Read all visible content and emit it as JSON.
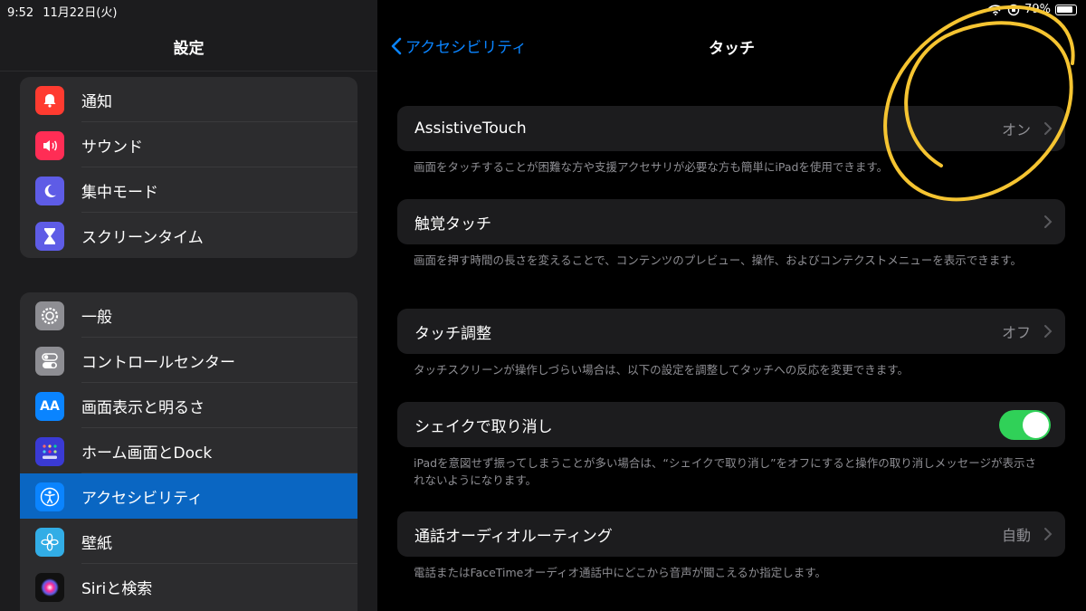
{
  "status": {
    "time": "9:52",
    "date": "11月22日(火)",
    "battery": "79%"
  },
  "sidebar": {
    "title": "設定",
    "group1": [
      {
        "label": "通知",
        "icon": "bell-icon",
        "color": "#ff3b30"
      },
      {
        "label": "サウンド",
        "icon": "speaker-icon",
        "color": "#ff2d55"
      },
      {
        "label": "集中モード",
        "icon": "moon-icon",
        "color": "#5e5ce6"
      },
      {
        "label": "スクリーンタイム",
        "icon": "hourglass-icon",
        "color": "#5e5ce6"
      }
    ],
    "group2": [
      {
        "label": "一般",
        "icon": "gear-icon",
        "color": "#8e8e93"
      },
      {
        "label": "コントロールセンター",
        "icon": "toggles-icon",
        "color": "#8e8e93"
      },
      {
        "label": "画面表示と明るさ",
        "icon": "text-size-icon",
        "icon_text": "AA",
        "color": "#0a84ff"
      },
      {
        "label": "ホーム画面とDock",
        "icon": "home-grid-icon",
        "color": "#3a3ad4"
      },
      {
        "label": "アクセシビリティ",
        "icon": "accessibility-icon",
        "color": "#0a84ff",
        "selected": true
      },
      {
        "label": "壁紙",
        "icon": "flower-icon",
        "color": "#32ade6"
      },
      {
        "label": "Siriと検索",
        "icon": "siri-icon",
        "color": "#111111"
      }
    ]
  },
  "nav": {
    "back_label": "アクセシビリティ",
    "title": "タッチ"
  },
  "settings": [
    {
      "label": "AssistiveTouch",
      "value": "オン",
      "desc": "画面をタッチすることが困難な方や支援アクセサリが必要な方も簡単にiPadを使用できます。"
    },
    {
      "label": "触覚タッチ",
      "value": "",
      "desc": "画面を押す時間の長さを変えることで、コンテンツのプレビュー、操作、およびコンテクストメニューを表示できます。"
    },
    {
      "label": "タッチ調整",
      "value": "オフ",
      "desc": "タッチスクリーンが操作しづらい場合は、以下の設定を調整してタッチへの反応を変更できます。"
    },
    {
      "label": "シェイクで取り消し",
      "toggle_on": true,
      "desc": "iPadを意図せず振ってしまうことが多い場合は、“シェイクで取り消し”をオフにすると操作の取り消しメッセージが表示されないようになります。"
    },
    {
      "label": "通話オーディオルーティング",
      "value": "自動",
      "desc": "電話またはFaceTimeオーディオ通話中にどこから音声が聞こえるか指定します。"
    }
  ],
  "colors": {
    "accent": "#0a84ff",
    "toggle_on": "#30d158",
    "annotation": "#f5c431"
  }
}
